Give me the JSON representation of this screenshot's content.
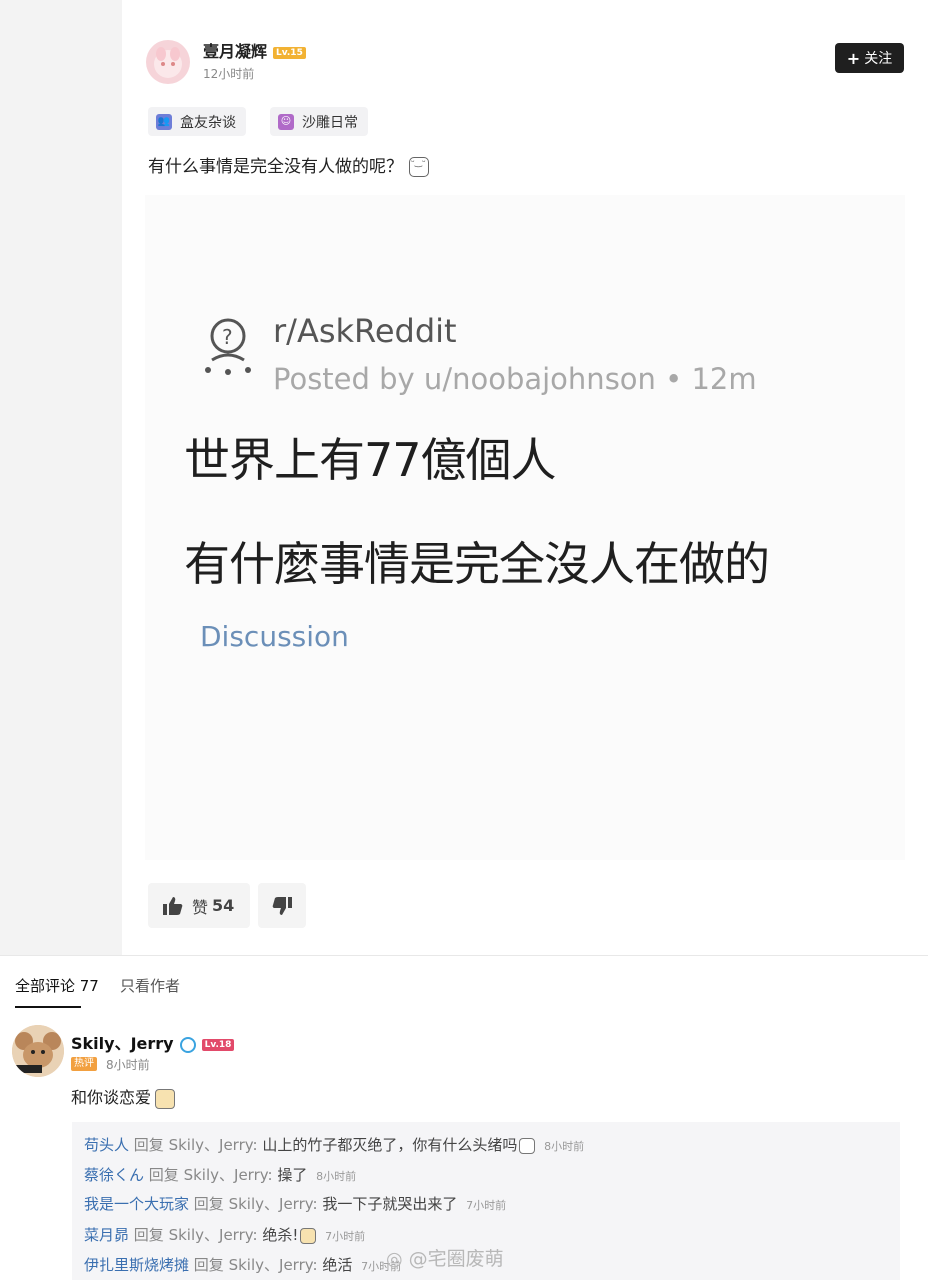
{
  "post": {
    "author": "壹月凝辉",
    "author_level": "Lv.15",
    "time": "12小时前",
    "follow_label": "关注",
    "tags": [
      "盒友杂谈",
      "沙雕日常"
    ],
    "title": "有什么事情是完全没有人做的呢？",
    "image": {
      "subreddit": "r/AskReddit",
      "posted_by": "Posted by u/noobajohnson • 12m",
      "line1": "世界上有77億個人",
      "line2": "有什麼事情是完全沒人在做的",
      "flair": "Discussion"
    },
    "like_label": "赞",
    "like_count": "54"
  },
  "comments_tabs": {
    "all_label": "全部评论 77",
    "author_only_label": "只看作者"
  },
  "comment": {
    "author": "Skily、Jerry",
    "level": "Lv.18",
    "hot_label": "热评",
    "time": "8小时前",
    "text": "和你谈恋爱"
  },
  "replies": [
    {
      "name": "苟头人",
      "reply_word": "回复",
      "target": "Skily、Jerry:",
      "text": "山上的竹子都灭绝了，你有什么头绪吗",
      "time": "8小时前"
    },
    {
      "name": "蔡徐くん",
      "reply_word": "回复",
      "target": "Skily、Jerry:",
      "text": "操了",
      "time": "8小时前"
    },
    {
      "name": "我是一个大玩家",
      "reply_word": "回复",
      "target": "Skily、Jerry:",
      "text": "我一下子就哭出来了",
      "time": "7小时前"
    },
    {
      "name": "菜月昴",
      "reply_word": "回复",
      "target": "Skily、Jerry:",
      "text": "绝杀!",
      "time": "7小时前"
    },
    {
      "name": "伊扎里斯烧烤摊",
      "reply_word": "回复",
      "target": "Skily、Jerry:",
      "text": "绝活",
      "time": "7小时前"
    }
  ],
  "watermark": "@宅圈废萌"
}
